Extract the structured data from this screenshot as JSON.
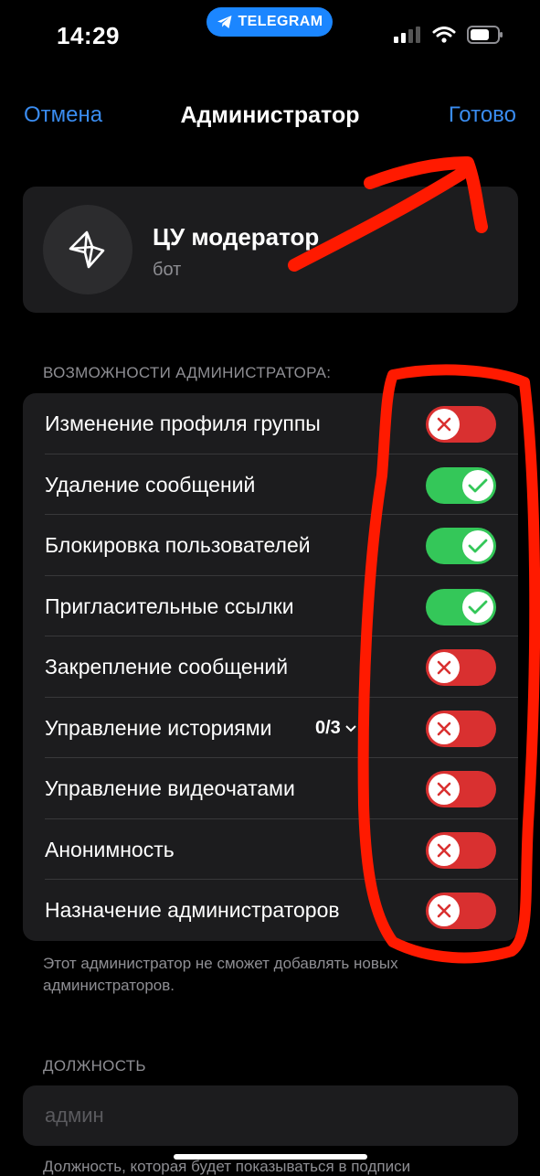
{
  "status_bar": {
    "time": "14:29",
    "pill_text": "TELEGRAM"
  },
  "nav": {
    "cancel": "Отмена",
    "title": "Администратор",
    "done": "Готово"
  },
  "bot": {
    "name": "ЦУ модератор",
    "subtitle": "бот"
  },
  "permissions": {
    "header": "ВОЗМОЖНОСТИ АДМИНИСТРАТОРА:",
    "rows": [
      {
        "label": "Изменение профиля группы",
        "enabled": false
      },
      {
        "label": "Удаление сообщений",
        "enabled": true
      },
      {
        "label": "Блокировка пользователей",
        "enabled": true
      },
      {
        "label": "Пригласительные ссылки",
        "enabled": true
      },
      {
        "label": "Закрепление сообщений",
        "enabled": false
      },
      {
        "label": "Управление историями",
        "counter": "0/3",
        "enabled": false
      },
      {
        "label": "Управление видеочатами",
        "enabled": false
      },
      {
        "label": "Анонимность",
        "enabled": false
      },
      {
        "label": "Назначение администраторов",
        "enabled": false
      }
    ],
    "footer": "Этот администратор не сможет добавлять новых администраторов."
  },
  "title_section": {
    "header": "ДОЛЖНОСТЬ",
    "placeholder": "админ",
    "note": "Должность, которая будет показываться в подписи"
  },
  "colors": {
    "accent": "#3a8cf0",
    "toggle_on": "#34c759",
    "toggle_off": "#d93030",
    "annotation": "#ff1a00"
  }
}
